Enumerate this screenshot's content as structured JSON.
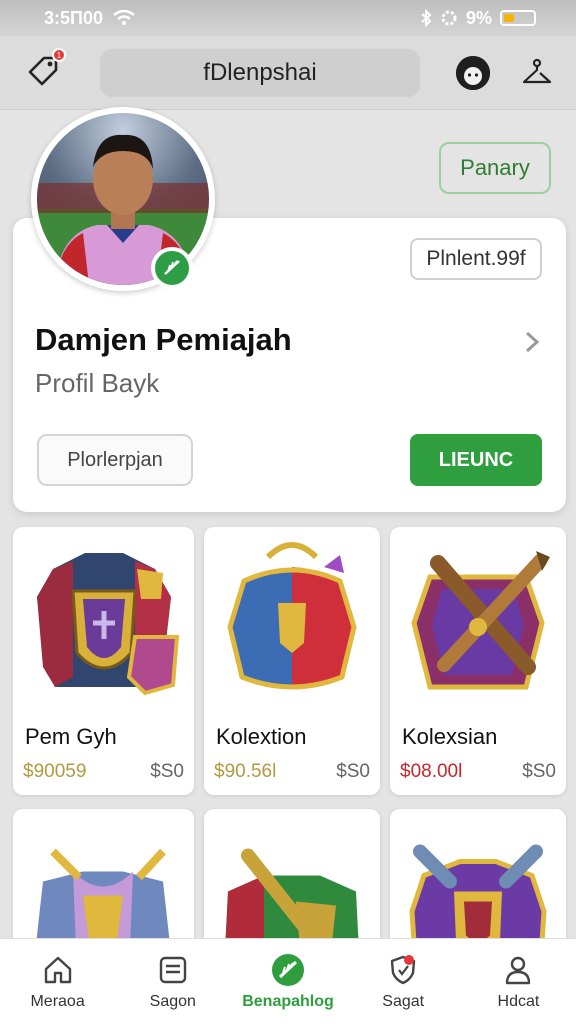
{
  "status": {
    "time": "3:5П00",
    "battery": "9%",
    "battery_level": 0.35
  },
  "header": {
    "search_text": "fDlenpshai",
    "notifications": "1"
  },
  "panary_button": "Panary",
  "profile": {
    "pin_label": "Plnlent.99f",
    "name": "Damjen Pemiajah",
    "subtitle": "Profil Bayk",
    "outline_button": "Plorlerpjan",
    "primary_button": "LIEUNC"
  },
  "items": [
    {
      "name": "Pem Gyh",
      "price": "$90059",
      "alt": "$S0",
      "price_color": "#b39a40"
    },
    {
      "name": "Kolextion",
      "price": "$90.56l",
      "alt": "$S0",
      "price_color": "#b39a40"
    },
    {
      "name": "Kolexsian",
      "price": "$08.00l",
      "alt": "$S0",
      "price_color": "#c62828"
    },
    {
      "name": "",
      "price": "",
      "alt": ""
    },
    {
      "name": "",
      "price": "",
      "alt": ""
    },
    {
      "name": "",
      "price": "",
      "alt": ""
    }
  ],
  "nav": [
    {
      "label": "Meraoa",
      "icon": "home-icon"
    },
    {
      "label": "Sagon",
      "icon": "list-icon"
    },
    {
      "label": "Benapahlog",
      "icon": "check-icon"
    },
    {
      "label": "Sagat",
      "icon": "shield-icon"
    },
    {
      "label": "Hdcat",
      "icon": "person-icon"
    }
  ],
  "colors": {
    "accent": "#2e9e3e",
    "gold": "#b39a40",
    "red": "#c62828"
  }
}
